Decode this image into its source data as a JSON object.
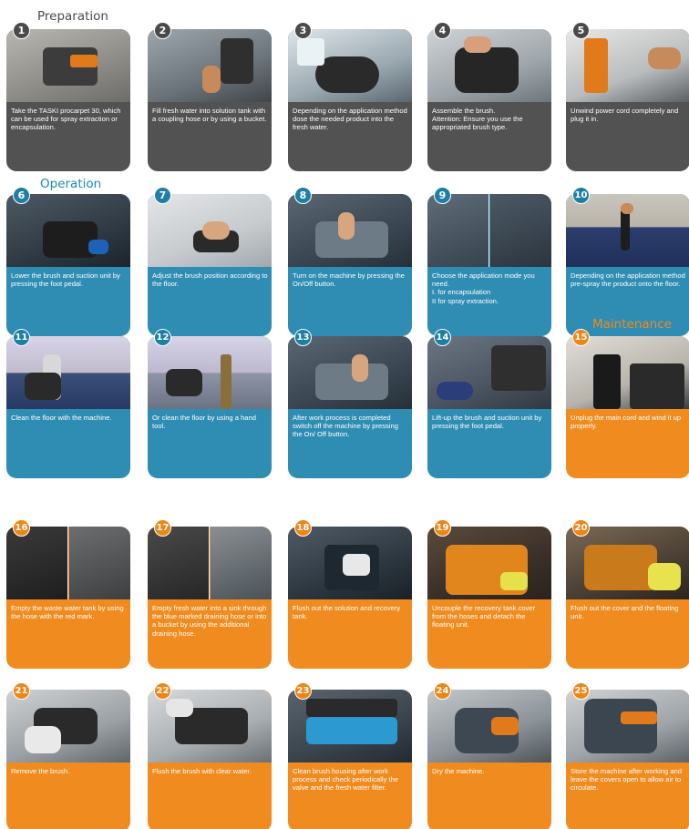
{
  "sections": {
    "preparation": "Preparation",
    "operation": "Operation",
    "maintenance": "Maintenance"
  },
  "colors": {
    "preparation": "#525252",
    "operation": "#2f8db4",
    "maintenance": "#f08c1f"
  },
  "steps": [
    {
      "num": "1",
      "text": "Take the TASKI procarpet 30, which can be used for spray extraction or encapsulation."
    },
    {
      "num": "2",
      "text": "Fill fresh water into solution tank with a coupling hose or by using a bucket."
    },
    {
      "num": "3",
      "text": "Depending on the application method dose the needed product into the fresh water."
    },
    {
      "num": "4",
      "text": "Assemble the brush.\nAttention: Ensure you use the appropriated brush type."
    },
    {
      "num": "5",
      "text": "Unwind power cord completely and plug it in."
    },
    {
      "num": "6",
      "text": "Lower the brush and suction unit by pressing the foot pedal."
    },
    {
      "num": "7",
      "text": "Adjust the brush position according to the floor."
    },
    {
      "num": "8",
      "text": "Turn on the machine by pressing the On/Off button."
    },
    {
      "num": "9",
      "text": "Choose the application mode you need.\nI. for encapsulation\nII for spray extraction."
    },
    {
      "num": "10",
      "text": "Depending on the application method pre-spray the product onto the floor."
    },
    {
      "num": "11",
      "text": "Clean the floor with the machine."
    },
    {
      "num": "12",
      "text": "Or clean the floor by using a hand tool."
    },
    {
      "num": "13",
      "text": "After work process is completed switch off the machine by pressing the On/ Off button."
    },
    {
      "num": "14",
      "text": "Lift-up the brush and suction unit by pressing the foot pedal."
    },
    {
      "num": "15",
      "text": "Unplug the main cord and wind it up properly."
    },
    {
      "num": "16",
      "text": "Empty the waste water tank by using the hose with the red mark."
    },
    {
      "num": "17",
      "text": "Empty fresh water into a sink through the blue marked draining hose or into a bucket by using the additional draining hose."
    },
    {
      "num": "18",
      "text": "Flush out the solution and recovery tank."
    },
    {
      "num": "19",
      "text": "Uncouple the recovery tank cover from the hoses and detach the floating unit."
    },
    {
      "num": "20",
      "text": "Flush out the cover and the floating unit."
    },
    {
      "num": "21",
      "text": "Remove the brush."
    },
    {
      "num": "22",
      "text": "Flush the brush with clear water."
    },
    {
      "num": "23",
      "text": "Clean brush housing after work process and check periodically the valve and the fresh water filter."
    },
    {
      "num": "24",
      "text": "Dry the machine."
    },
    {
      "num": "25",
      "text": "Store the machine after working and leave the covers open to allow air to circulate."
    }
  ]
}
